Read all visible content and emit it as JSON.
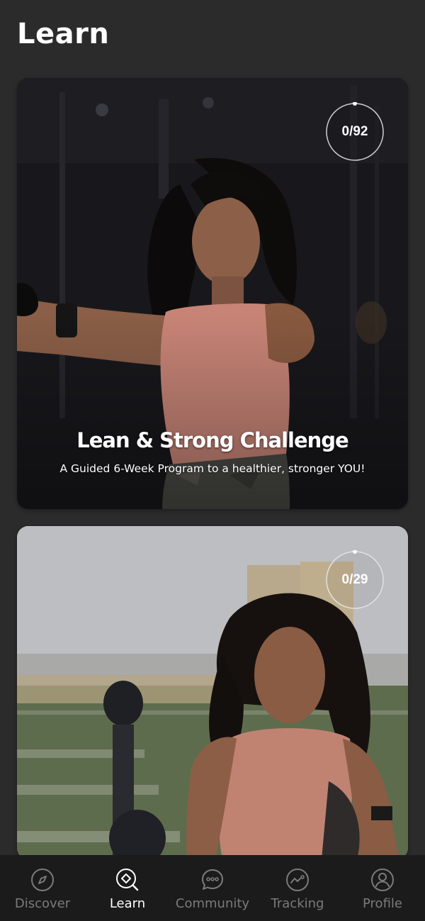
{
  "header": {
    "title": "Learn"
  },
  "courses": [
    {
      "title": "Lean & Strong Challenge",
      "subtitle": "A Guided 6-Week Program to a healthier, stronger YOU!",
      "progress_label": "0/92",
      "completed": 0,
      "total": 92,
      "photo": "woman-swinging-kettlebell-in-gym"
    },
    {
      "title": "",
      "subtitle": "",
      "progress_label": "0/29",
      "completed": 0,
      "total": 29,
      "photo": "woman-smiling-in-plank-on-turf"
    }
  ],
  "bottom_nav": {
    "items": [
      {
        "label": "Discover",
        "icon": "compass-icon",
        "active": false
      },
      {
        "label": "Learn",
        "icon": "search-diamond-icon",
        "active": true
      },
      {
        "label": "Community",
        "icon": "chat-bubble-icon",
        "active": false
      },
      {
        "label": "Tracking",
        "icon": "trend-chart-icon",
        "active": false
      },
      {
        "label": "Profile",
        "icon": "user-circle-icon",
        "active": false
      }
    ]
  },
  "colors": {
    "background": "#2b2b2b",
    "nav_background": "#1b1b1b",
    "nav_inactive": "#7b7b7b",
    "nav_active": "#ffffff",
    "ring_track": "#cfcfcf",
    "text": "#ffffff"
  }
}
